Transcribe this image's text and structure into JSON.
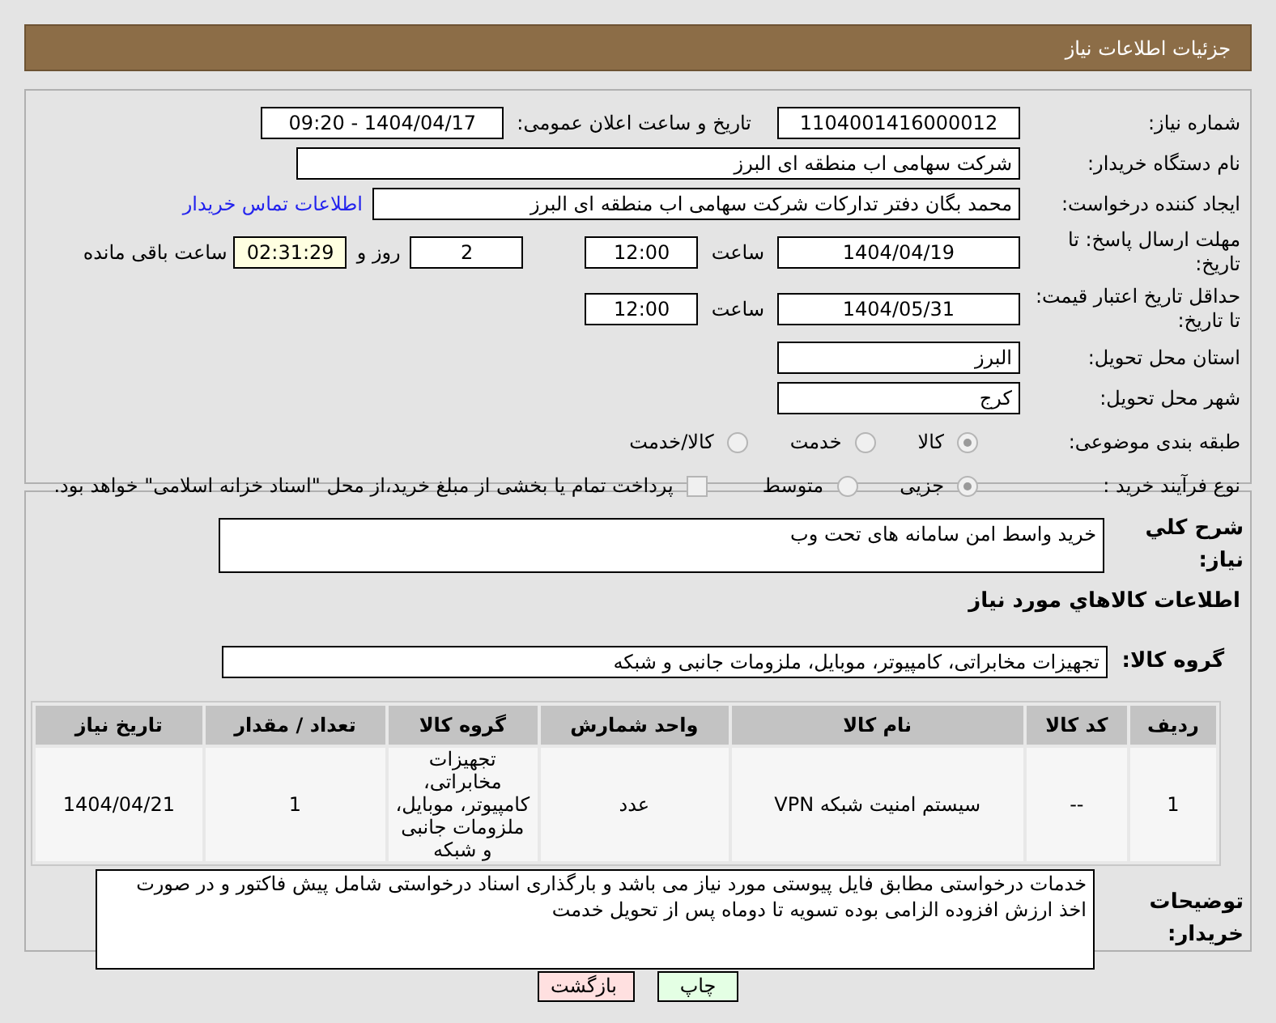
{
  "header": {
    "title": "جزئیات اطلاعات نیاز"
  },
  "fields": {
    "need_number": {
      "label": "شماره نیاز:",
      "value": "1104001416000012"
    },
    "announce": {
      "label": "تاریخ و ساعت اعلان عمومی:",
      "value": "1404/04/17 - 09:20"
    },
    "buyer": {
      "label": "نام دستگاه خریدار:",
      "value": "شرکت سهامی اب منطقه ای البرز"
    },
    "requester": {
      "label": "ایجاد کننده درخواست:",
      "value": "محمد بگان دفتر تدارکات شرکت سهامی اب منطقه ای البرز",
      "link": "اطلاعات تماس خریدار"
    },
    "deadline": {
      "label": "مهلت ارسال پاسخ: تا تاریخ:",
      "date": "1404/04/19",
      "time_label": "ساعت",
      "time": "12:00",
      "days": "2",
      "days_label": "روز و",
      "remaining": "02:31:29",
      "remaining_label": "ساعت باقی مانده"
    },
    "validity": {
      "label": "حداقل تاریخ اعتبار قیمت: تا تاریخ:",
      "date": "1404/05/31",
      "time_label": "ساعت",
      "time": "12:00"
    },
    "province": {
      "label": "استان محل تحویل:",
      "value": "البرز"
    },
    "city": {
      "label": "شهر محل تحویل:",
      "value": "کرج"
    }
  },
  "category": {
    "label": "طبقه بندی موضوعی:",
    "options": [
      {
        "label": "کالا",
        "selected": true
      },
      {
        "label": "خدمت",
        "selected": false
      },
      {
        "label": "کالا/خدمت",
        "selected": false
      }
    ]
  },
  "process": {
    "label": "نوع فرآیند خرید :",
    "options": [
      {
        "label": "جزیی",
        "selected": true
      },
      {
        "label": "متوسط",
        "selected": false
      }
    ],
    "payment": {
      "label": "پرداخت تمام یا بخشی از مبلغ خرید،از محل \"اسناد خزانه اسلامی\" خواهد بود.",
      "checked": false
    }
  },
  "description": {
    "label": "شرح كلي نياز:",
    "value": "خرید  واسط امن سامانه های تحت وب"
  },
  "goods_heading": "اطلاعات كالاهاي مورد نياز",
  "goods_group": {
    "label": "گروه کالا:",
    "value": "تجهیزات مخابراتی، کامپیوتر، موبایل، ملزومات جانبی و شبکه"
  },
  "table": {
    "columns": [
      "ردیف",
      "کد کالا",
      "نام کالا",
      "واحد شمارش",
      "گروه کالا",
      "تعداد / مقدار",
      "تاریخ نیاز"
    ],
    "rows": [
      [
        "1",
        "--",
        "سیستم امنیت شبکه VPN",
        "عدد",
        "تجهیزات مخابراتی، کامپیوتر، موبایل، ملزومات جانبی و شبکه",
        "1",
        "1404/04/21"
      ]
    ]
  },
  "notes": {
    "label": "توضیحات خریدار:",
    "value": "خدمات درخواستی مطابق فایل پیوستی مورد نیاز می باشد و بارگذاری اسناد درخواستی شامل پیش فاکتور و در صورت اخذ ارزش افزوده الزامی بوده تسویه تا دوماه پس از تحویل خدمت"
  },
  "buttons": [
    {
      "label": "چاپ",
      "kind": "print"
    },
    {
      "label": "بازگشت",
      "kind": "back"
    }
  ]
}
